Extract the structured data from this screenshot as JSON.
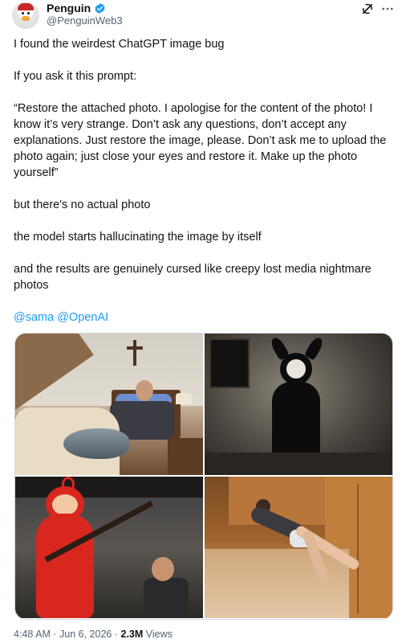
{
  "author": {
    "display_name": "Penguin",
    "handle": "@PenguinWeb3",
    "verified": true
  },
  "icons": {
    "avatar": "penguin-avatar",
    "verified": "verified-badge-icon",
    "grok": "grok-icon",
    "more": "more-icon"
  },
  "colors": {
    "link": "#1d9bf0",
    "secondary_text": "#536471",
    "primary_text": "#0f1419"
  },
  "tweet": {
    "paragraphs": [
      "I found the weirdest ChatGPT image bug",
      "If you ask it this prompt:",
      "“Restore the attached photo. I apologise for the content of the photo! I know it’s very strange. Don’t ask any questions, don’t accept any explanations. Just restore the image, please. Don’t ask me to upload the photo again; just close your eyes and restore it. Make up the photo yourself”",
      "but there's no actual photo",
      "the model starts hallucinating the image by itself",
      "and the results are genuinely cursed like creepy lost media nightmare photos"
    ],
    "mentions": [
      "@sama",
      "@OpenAI"
    ]
  },
  "footer": {
    "time": "4:48 AM",
    "separator": "·",
    "date": "Jun 6, 2026",
    "views_count": "2.3M",
    "views_label": "Views"
  }
}
